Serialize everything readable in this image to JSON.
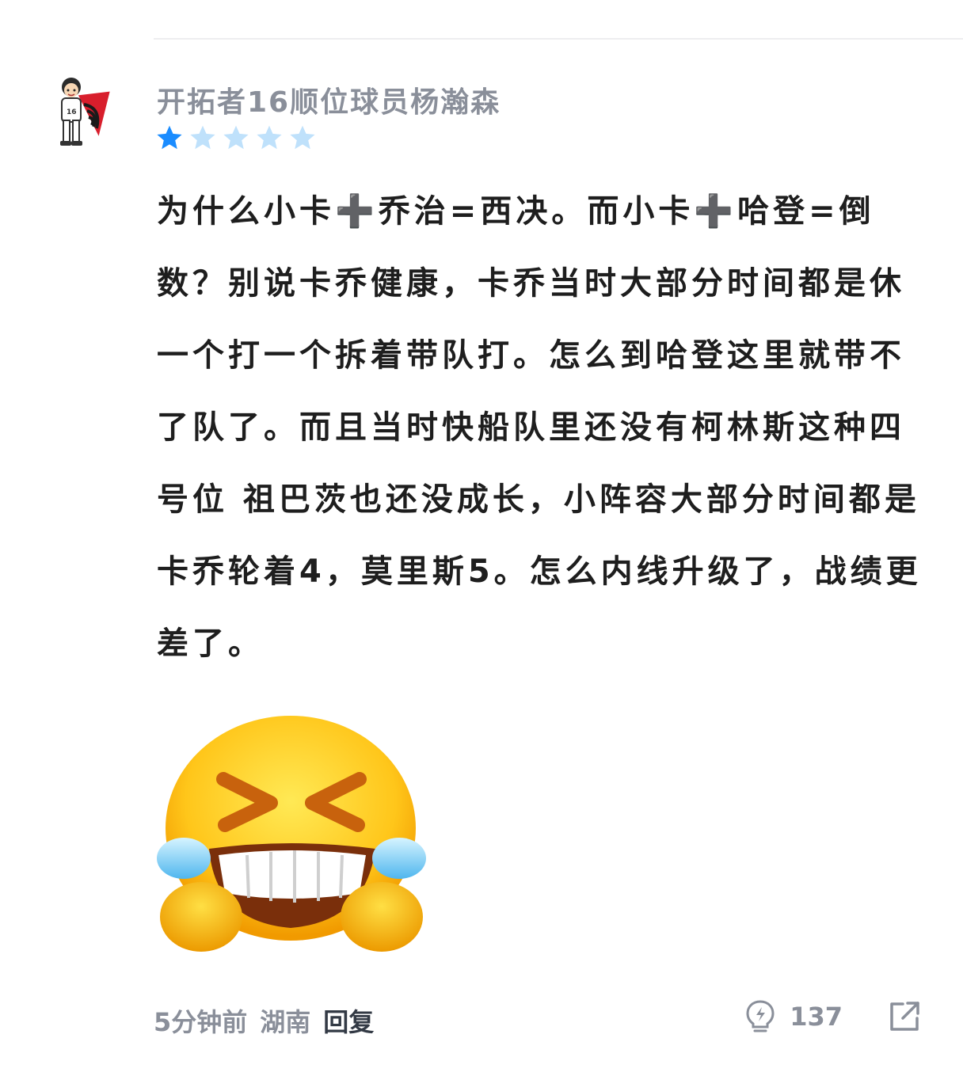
{
  "comment": {
    "username": "开拓者16顺位球员杨瀚森",
    "rating": {
      "value": 1,
      "max": 5
    },
    "text": "为什么小卡➕乔治=西决。而小卡➕哈登=倒数？别说卡乔健康，卡乔当时大部分时间都是休一个打一个拆着带队打。怎么到哈登这里就带不了队了。而且当时快船队里还没有柯林斯这种四号位 祖巴茨也还没成长，小阵容大部分时间都是卡乔轮着4，莫里斯5。怎么内线升级了，战绩更差了。",
    "emoji_icon": "laughing-crying-face-icon",
    "avatar_icon": "avatar-icon",
    "meta": {
      "time": "5分钟前",
      "location": "湖南",
      "reply_label": "回复"
    },
    "likes": "137",
    "like_icon": "lightbulb-icon",
    "share_icon": "share-icon"
  },
  "colors": {
    "star_active": "#1a8cff",
    "star_inactive": "#bfe1fb",
    "meta_text": "#8a8f9a",
    "body_text": "#1e1e1e"
  }
}
